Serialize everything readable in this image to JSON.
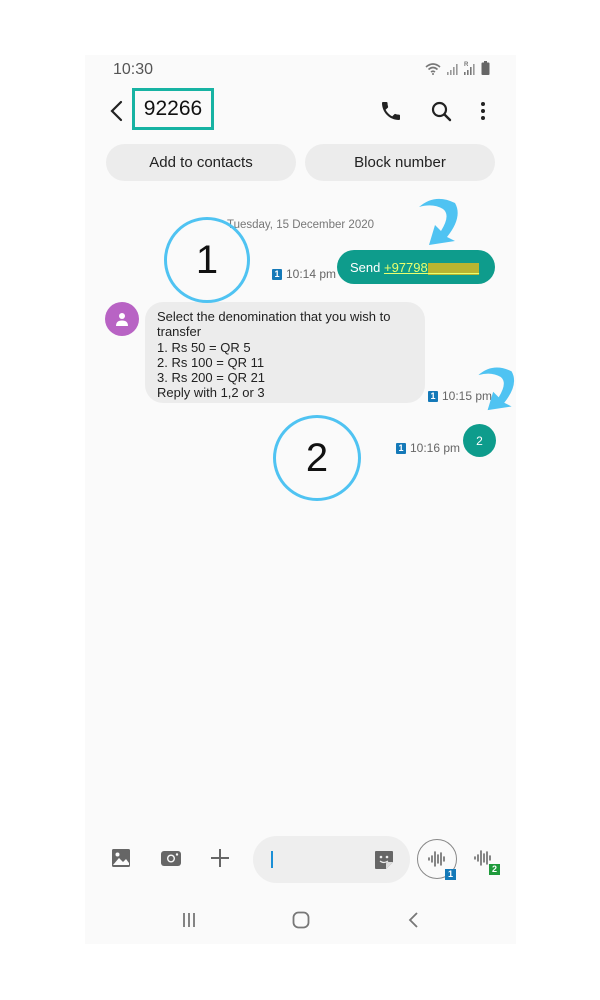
{
  "status_bar": {
    "time": "10:30",
    "icons": [
      "wifi-icon",
      "signal-icon",
      "roaming-signal-icon",
      "battery-icon"
    ],
    "roaming_label": "R"
  },
  "header": {
    "back_icon": "back-arrow-icon",
    "title": "92266",
    "actions": [
      "phone-call-icon",
      "search-icon",
      "more-options-icon"
    ]
  },
  "actions": {
    "add_to_contacts": "Add to contacts",
    "block_number": "Block number"
  },
  "conversation": {
    "date_divider": "Tuesday, 15 December 2020",
    "messages": [
      {
        "direction": "outgoing",
        "text_prefix": "Send ",
        "link_text": "+97798",
        "masked_text": "XXXXXXX",
        "sim": "1",
        "time": "10:14 pm"
      },
      {
        "direction": "incoming",
        "lines": [
          "Select the denomination that you wish to",
          "transfer",
          "1. Rs 50 = QR 5",
          "2. Rs 100 = QR 11",
          "3. Rs 200 = QR 21",
          "Reply with 1,2 or 3"
        ],
        "sim": "1",
        "time": "10:15 pm"
      },
      {
        "direction": "outgoing",
        "text": "2",
        "sim": "1",
        "time": "10:16 pm"
      }
    ]
  },
  "annotations": {
    "step1": "1",
    "step2": "2",
    "color": "#4fc3f2"
  },
  "composer": {
    "input_value": "",
    "icons": [
      "gallery-icon",
      "camera-icon",
      "add-icon",
      "sticker-icon"
    ],
    "voice_sim1_badge": "1",
    "voice_sim2_badge": "2"
  },
  "nav_bar": {
    "icons": [
      "recent-apps-icon",
      "home-icon",
      "back-icon"
    ]
  },
  "colors": {
    "accent": "#0e9c8c",
    "title_highlight": "#17b3a3",
    "sim1": "#1479b8",
    "sim2": "#1f9a3b",
    "avatar": "#b863c4"
  }
}
